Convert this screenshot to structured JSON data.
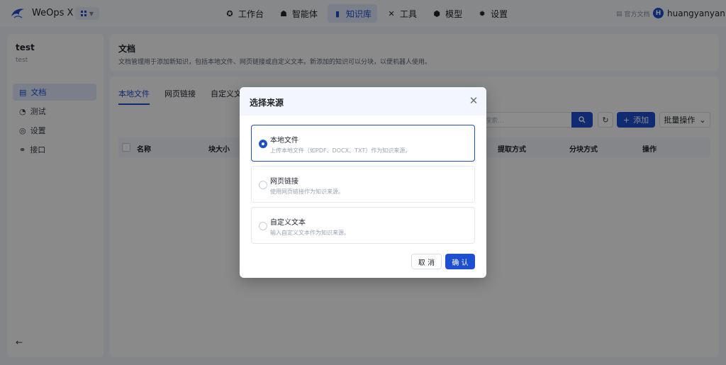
{
  "app": {
    "title": "WeOps X",
    "switch_icon": "grid-icon"
  },
  "nav": [
    {
      "label": "工作台",
      "icon": "robot-icon"
    },
    {
      "label": "智能体",
      "icon": "agent-icon"
    },
    {
      "label": "知识库",
      "icon": "library-icon",
      "active": true
    },
    {
      "label": "工具",
      "icon": "tools-icon"
    },
    {
      "label": "模型",
      "icon": "cube-icon"
    },
    {
      "label": "设置",
      "icon": "gear-icon"
    }
  ],
  "header_right": {
    "docs_label": "官方文档",
    "user_initial": "H",
    "user_name": "huangyanyan"
  },
  "sidebar": {
    "kb_name": "test",
    "kb_desc": "test",
    "items": [
      {
        "label": "文档",
        "icon": "document-icon",
        "active": true
      },
      {
        "label": "测试",
        "icon": "gauge-icon"
      },
      {
        "label": "设置",
        "icon": "settings-icon"
      },
      {
        "label": "接口",
        "icon": "link-icon"
      }
    ],
    "collapse_icon": "arrow-left-icon"
  },
  "page_header": {
    "title": "文档",
    "description": "文档管理用于添加新知识，包括本地文件、网页链接或自定义文本。新添加的知识可以分块，以便机器人使用。"
  },
  "tabs": [
    "本地文件",
    "网页链接",
    "自定义文本"
  ],
  "toolbar": {
    "search_placeholder": "搜索...",
    "add_label": "添加",
    "batch_label": "批量操作"
  },
  "table": {
    "columns": [
      "名称",
      "块大小",
      "提取方式",
      "分块方式",
      "操作"
    ]
  },
  "modal": {
    "title": "选择来源",
    "options": [
      {
        "title": "本地文件",
        "desc": "上传本地文件（如PDF、DOCX、TXT）作为知识来源。",
        "selected": true
      },
      {
        "title": "网页链接",
        "desc": "使用网页链接作为知识来源。",
        "selected": false
      },
      {
        "title": "自定义文本",
        "desc": "输入自定义文本作为知识来源。",
        "selected": false
      }
    ],
    "cancel_label": "取 消",
    "ok_label": "确 认"
  },
  "colors": {
    "primary": "#1f4fd1",
    "overlay": "rgba(0,0,0,0.45)"
  }
}
